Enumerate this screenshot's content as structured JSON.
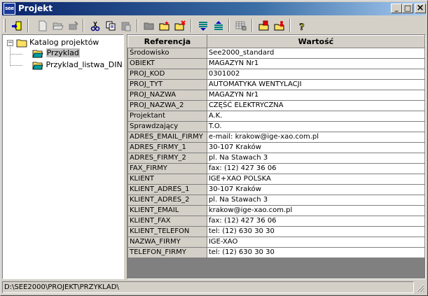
{
  "window": {
    "title": "Projekt",
    "app_icon_text": "see",
    "controls": {
      "minimize": "_",
      "maximize": "□",
      "close": "×"
    }
  },
  "toolbar": {
    "buttons": [
      "exit-icon",
      "new-document-icon",
      "open-folder-icon",
      "disabled-tool-icon",
      "cut-icon",
      "copy-icon",
      "paste-icon",
      "folder-gray-icon",
      "folder-new-icon",
      "folder-delete-icon",
      "list-down-icon",
      "list-up-icon",
      "grid-tool-icon",
      "folder-red-icon",
      "folder-person-icon",
      "help-icon"
    ]
  },
  "tree": {
    "root_label": "Katalog projektów",
    "expand_symbol": "−",
    "items": [
      {
        "label": "Przyklad",
        "selected": true
      },
      {
        "label": "Przyklad_listwa_DIN",
        "selected": false
      }
    ]
  },
  "grid": {
    "headers": {
      "ref": "Referencja",
      "val": "Wartość"
    },
    "rows": [
      {
        "ref": "Środowisko",
        "val": "See2000_standard"
      },
      {
        "ref": "OBIEKT",
        "val": "MAGAZYN Nr1"
      },
      {
        "ref": "PROJ_KOD",
        "val": "0301002"
      },
      {
        "ref": "PROJ_TYT",
        "val": "AUTOMATYKA WENTYLACJI"
      },
      {
        "ref": "PROJ_NAZWA",
        "val": "MAGAZYN Nr1"
      },
      {
        "ref": "PROJ_NAZWA_2",
        "val": "CZĘŚĆ ELEKTRYCZNA"
      },
      {
        "ref": "Projektant",
        "val": "A.K."
      },
      {
        "ref": "Sprawdzający",
        "val": "T.O."
      },
      {
        "ref": "ADRES_EMAIL_FIRMY",
        "val": "e-mail: krakow@ige-xao.com.pl"
      },
      {
        "ref": "ADRES_FIRMY_1",
        "val": "30-107 Kraków"
      },
      {
        "ref": "ADRES_FIRMY_2",
        "val": "pl. Na Stawach 3"
      },
      {
        "ref": "FAX_FIRMY",
        "val": "fax: (12) 427 36 06"
      },
      {
        "ref": "KLIENT",
        "val": "IGE+XAO POLSKA"
      },
      {
        "ref": "KLIENT_ADRES_1",
        "val": "30-107 Kraków"
      },
      {
        "ref": "KLIENT_ADRES_2",
        "val": "pl. Na Stawach 3"
      },
      {
        "ref": "KLIENT_EMAIL",
        "val": "krakow@ige-xao.com.pl"
      },
      {
        "ref": "KLIENT_FAX",
        "val": "fax: (12) 427 36 06"
      },
      {
        "ref": "KLIENT_TELEFON",
        "val": "tel: (12) 630 30 30"
      },
      {
        "ref": "NAZWA_FIRMY",
        "val": "IGE-XAO"
      },
      {
        "ref": "TELEFON_FIRMY",
        "val": "tel: (12) 630 30 30"
      }
    ]
  },
  "statusbar": {
    "path": "D:\\SEE2000\\PROJEKT\\PRZYKLAD\\"
  },
  "colors": {
    "titlebar_start": "#0a246a",
    "titlebar_end": "#a6caf0",
    "face": "#d4d0c8",
    "selection": "#c0c0c0"
  }
}
